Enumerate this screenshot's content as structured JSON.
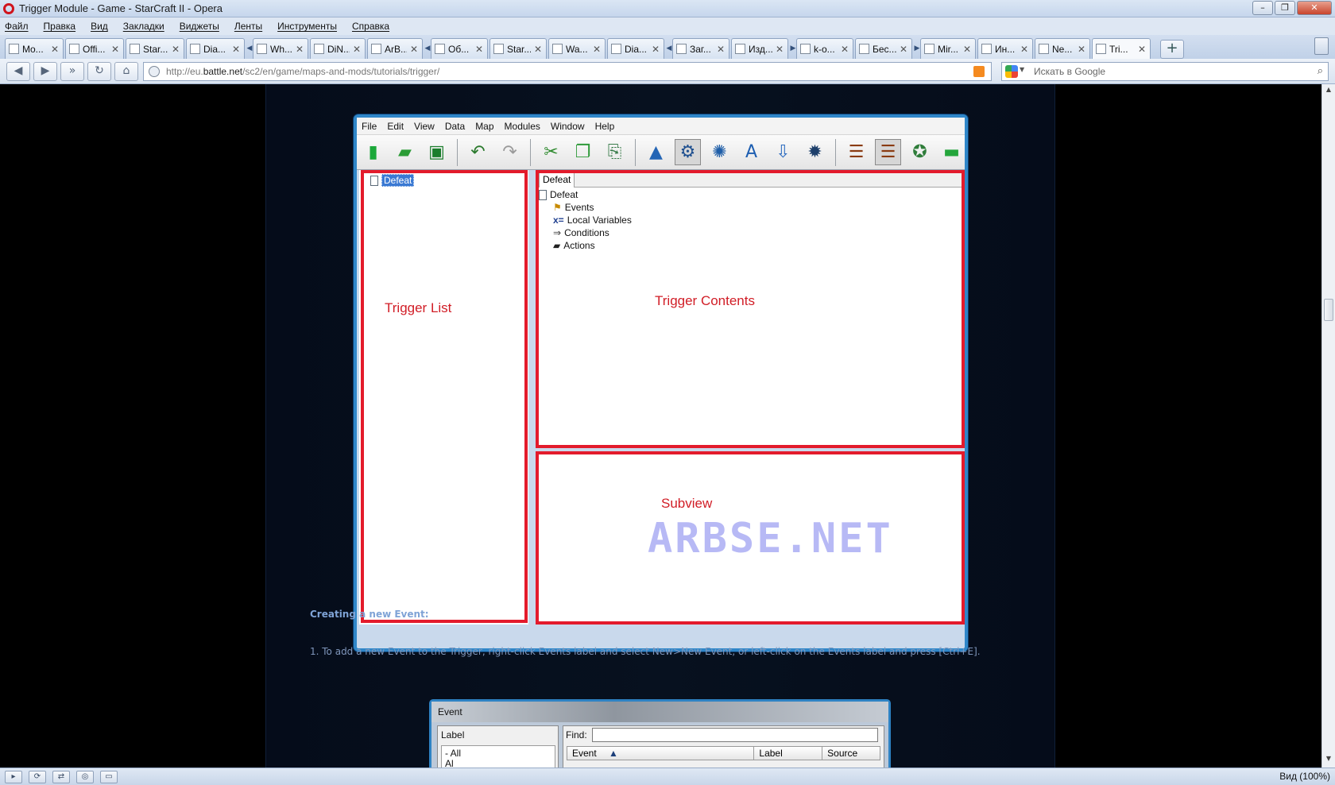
{
  "window": {
    "title": "Trigger Module - Game - StarCraft II - Opera"
  },
  "menu": [
    "Файл",
    "Правка",
    "Вид",
    "Закладки",
    "Виджеты",
    "Ленты",
    "Инструменты",
    "Справка"
  ],
  "tabs": [
    {
      "label": "Mo..."
    },
    {
      "label": "Offi..."
    },
    {
      "label": "Star..."
    },
    {
      "label": "Dia..."
    },
    {
      "label": "Wh..."
    },
    {
      "label": "DiN..."
    },
    {
      "label": "ArB..."
    },
    {
      "label": "Об..."
    },
    {
      "label": "Star..."
    },
    {
      "label": "Wa..."
    },
    {
      "label": "Dia..."
    },
    {
      "label": "Заг..."
    },
    {
      "label": "Изд..."
    },
    {
      "label": "k-o..."
    },
    {
      "label": "Бес..."
    },
    {
      "label": "Mir..."
    },
    {
      "label": "Ин..."
    },
    {
      "label": "Ne..."
    },
    {
      "label": "Tri..."
    }
  ],
  "address": {
    "url_prefix": "http://eu.",
    "url_domain": "battle.net",
    "url_path": "/sc2/en/game/maps-and-mods/tutorials/trigger/",
    "search_placeholder": "Искать в Google"
  },
  "editor": {
    "menu": [
      "File",
      "Edit",
      "View",
      "Data",
      "Map",
      "Modules",
      "Window",
      "Help"
    ],
    "trigger_list": {
      "label": "Trigger List",
      "selected_item": "Defeat"
    },
    "trigger_contents": {
      "label": "Trigger Contents",
      "tab": "Defeat",
      "root": "Defeat",
      "items": [
        "Events",
        "Local Variables",
        "Conditions",
        "Actions"
      ]
    },
    "subview": {
      "label": "Subview"
    },
    "watermark": "ARBSE.NET"
  },
  "article": {
    "heading": "Creating a new Event:",
    "step1": "1. To add a new Event to the Trigger, right-click Events label and select New>New Event, or left-click on the Events label and press [Ctrl+E]."
  },
  "event_dialog": {
    "title": "Event",
    "label_caption": "Label",
    "find_caption": "Find:",
    "label_list": [
      "- All",
      "Al"
    ],
    "columns": [
      "Event",
      "Label",
      "Source"
    ]
  },
  "status": {
    "zoom": "Вид (100%)"
  }
}
